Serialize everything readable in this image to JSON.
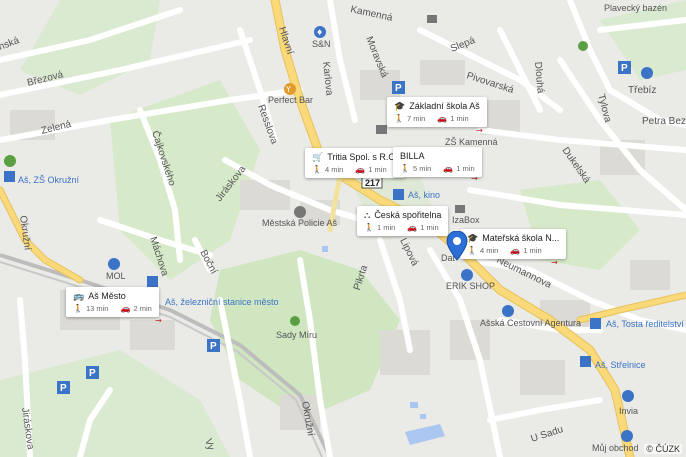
{
  "copyright": "© ČÚZK",
  "streets": {
    "hlavni": "Hlavní",
    "kamenna": "Kamenná",
    "moravska": "Moravská",
    "slepa": "Slepá",
    "pivovarska": "Pivovarská",
    "dlouha": "Dlouhá",
    "tylova": "Tylova",
    "trebizsk": "Třebíz",
    "petra_bez": "Petra Bez",
    "brezova": "Březová",
    "zelena": "Zelená",
    "karlova": "Karlova",
    "resslova": "Resslova",
    "cajkovskeho": "Čajkovského",
    "jiraskova": "Jiráskova",
    "okruzni_w": "Okružní",
    "machova": "Máchova",
    "bocni": "Boční",
    "lipova": "Lipová",
    "palackeho": "Pikrta",
    "neumannova": "Neumannova",
    "dukelska": "Dukelská",
    "okruzni_s": "Okružní",
    "u_sadu": "U Sadu",
    "vy": "Vy",
    "jirakova": "Jiráskova",
    "nska": "nská",
    "road_217": "217"
  },
  "places": {
    "plavecky_bazen": "Plavecký bazén",
    "sn": "S&N",
    "perfect_bar": "Perfect Bar",
    "zs_kamenna": "ZŠ Kamenná",
    "as_zs_okruzni": "Aš, ZŠ Okružní",
    "as_kino": "Aš, kino",
    "mestska_policie": "Městská Policie Aš",
    "izabox": "IzaBox",
    "mol": "MOL",
    "dat": "Dat",
    "erik_shop": "ERIK SHOP",
    "as_zelezn": "Aš, železniční stanice město",
    "sady_miru": "Sady Míru",
    "asska_cestovni": "Ašská Cestovní Agentura",
    "as_tosta": "Aš, Tosta ředitelství",
    "as_strelnice": "Aš, Střelnice",
    "invia": "Invia",
    "muj_obchod": "Můj obchod"
  },
  "cards": [
    {
      "title": "Základní škola Aš",
      "icon": "school-icon",
      "walk": "7 min",
      "car": "1 min"
    },
    {
      "title": "Tritia Spol. s R.O.",
      "icon": "shopping-cart-icon",
      "walk": "4 min",
      "car": "1 min"
    },
    {
      "title": "BILLA",
      "icon": "",
      "walk": "5 min",
      "car": "1 min"
    },
    {
      "title": "Česká spořitelna",
      "icon": "bank-network-icon",
      "walk": "1 min",
      "car": "1 min"
    },
    {
      "title": "Mateřská škola N...",
      "icon": "school-icon",
      "walk": "4 min",
      "car": "1 min"
    },
    {
      "title": "Aš Město",
      "icon": "bus-icon",
      "walk": "13 min",
      "car": "2 min"
    }
  ],
  "colors": {
    "background": "#eaeae6",
    "park": "#cfe6c0",
    "road_major": "#f9d97a",
    "road_minor": "#ffffff",
    "building": "#d9d7d2",
    "water": "#a9c7f0",
    "pin": "#2b6fd6",
    "transit_label": "#3b73c7"
  }
}
